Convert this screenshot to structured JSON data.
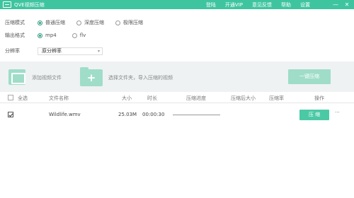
{
  "titlebar": {
    "title": "QVE视频压缩",
    "menu": [
      "登陆",
      "开通VIP",
      "意见反馈",
      "帮助",
      "设置"
    ],
    "minimize": "—",
    "close": "✕"
  },
  "options": {
    "mode_label": "压缩模式",
    "modes": [
      "普通压缩",
      "深度压缩",
      "极限压缩"
    ],
    "mode_selected": "普通压缩",
    "format_label": "输出格式",
    "formats": [
      "mp4",
      "flv"
    ],
    "format_selected": "mp4",
    "resolution_label": "分辨率",
    "resolution_value": "原分辨率",
    "resolution_arrow": "▾"
  },
  "toolbar": {
    "add_file": "添加视频文件",
    "add_folder": "选择文件夹，导入压缩的视频",
    "folder_plus": "+",
    "compress_all": "一键压缩"
  },
  "table": {
    "headers": {
      "select_all": "全选",
      "filename": "文件名称",
      "size": "大小",
      "duration": "时长",
      "progress": "压缩进度",
      "compressed_size": "压缩后大小",
      "ratio": "压缩率",
      "action": "操作"
    },
    "rows": [
      {
        "checked": true,
        "filename": "Wildlife.wmv",
        "size": "25.03M",
        "duration": "00:00:30",
        "progress": 0,
        "compressed_size": "",
        "ratio": "",
        "action": "压 缩",
        "more": "···"
      }
    ]
  },
  "colors": {
    "accent": "#3ec5a0",
    "button_light": "#9fddc9",
    "button": "#4bc9a5",
    "band": "#eef2f2"
  }
}
